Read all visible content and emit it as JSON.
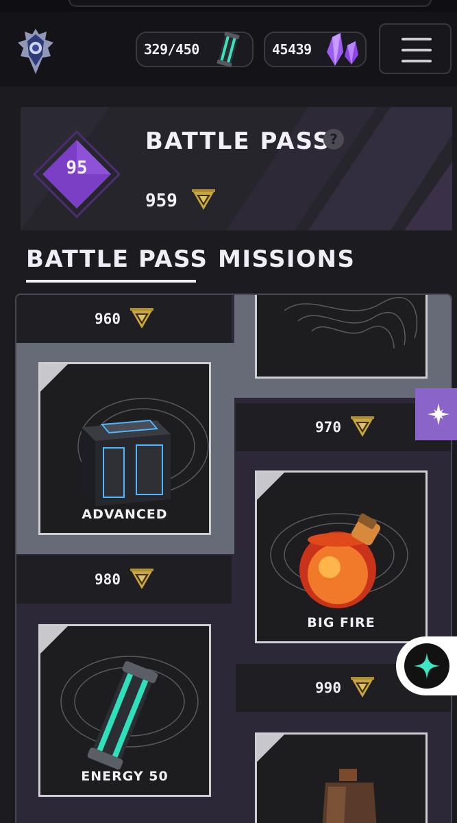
{
  "header": {
    "energy": "329/450",
    "gems": "45439",
    "logo_icon": "shield-emblem-icon",
    "energy_icon": "energy-cell-icon",
    "gem_icon": "purple-crystal-icon",
    "menu_icon": "hamburger-menu-icon"
  },
  "battle_pass": {
    "level": "95",
    "title": "BATTLE PASS",
    "help": "?",
    "points": "959",
    "points_icon": "battle-pass-badge-icon"
  },
  "tabs": [
    {
      "label": "BATTLE PASS",
      "active": true
    },
    {
      "label": "MISSIONS",
      "active": false
    }
  ],
  "track": {
    "tiers": [
      {
        "points": "960"
      },
      {
        "points": "970"
      },
      {
        "points": "980"
      },
      {
        "points": "990"
      }
    ],
    "rewards": [
      {
        "label": "",
        "icon": "reward-item-icon"
      },
      {
        "label": "ADVANCED",
        "icon": "advanced-crate-icon"
      },
      {
        "label": "BIG FIRE",
        "icon": "fire-potion-icon"
      },
      {
        "label": "ENERGY 50",
        "icon": "energy-cell-icon"
      },
      {
        "label": "",
        "icon": "potion-bottle-icon"
      }
    ]
  },
  "colors": {
    "accent_purple": "#8a64c8",
    "gold": "#c9a640",
    "background": "#1c1b1f"
  }
}
